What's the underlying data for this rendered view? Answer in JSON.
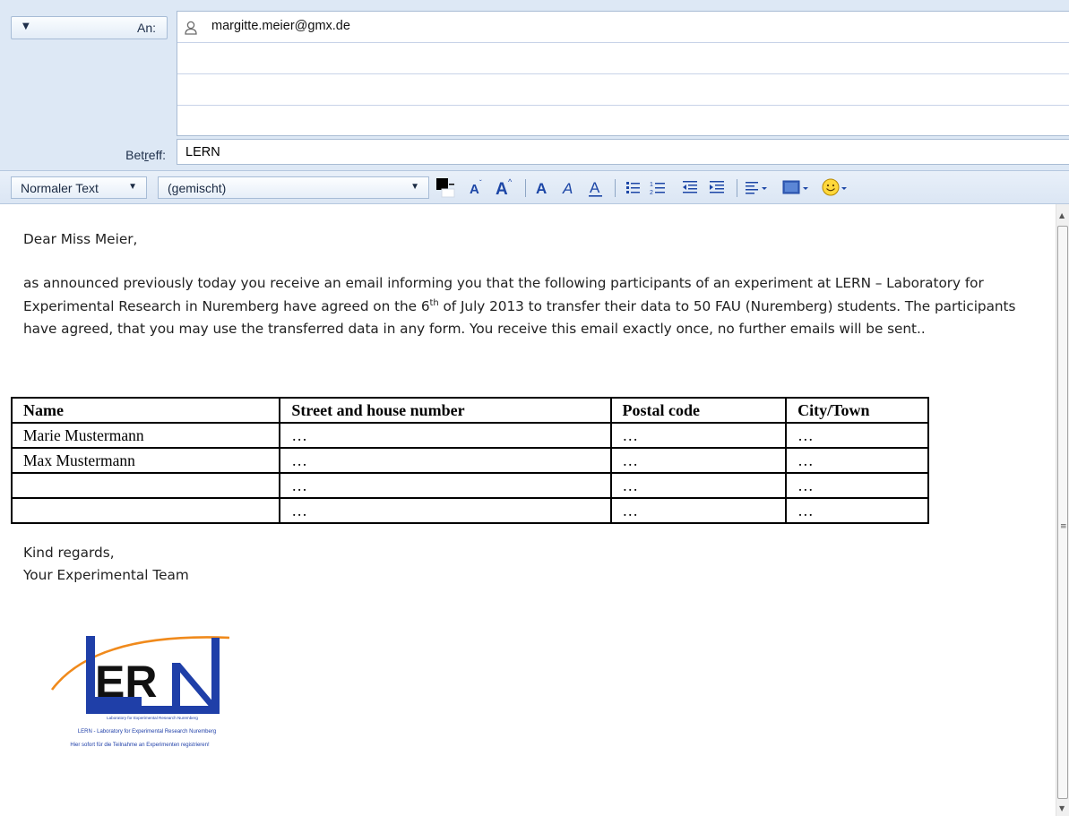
{
  "compose": {
    "address_type": "An:",
    "recipients": [
      "margitte.meier@gmx.de",
      "",
      "",
      ""
    ],
    "subject_label_pre": "Bet",
    "subject_label_key": "r",
    "subject_label_post": "eff:",
    "subject": "LERN"
  },
  "toolbar": {
    "paragraph_style": "Normaler Text",
    "font": "(gemischt)",
    "icons": [
      "text-color-icon",
      "font-smaller-icon",
      "font-larger-icon",
      "bold-icon",
      "italic-icon",
      "underline-icon",
      "bullet-list-icon",
      "numbered-list-icon",
      "outdent-icon",
      "indent-icon",
      "align-icon",
      "insert-image-icon",
      "smiley-icon"
    ]
  },
  "message": {
    "greeting": "Dear Miss Meier,",
    "paragraph_part1": "as announced previously today you receive an email informing you that the following participants of an experiment at LERN – Laboratory for Experimental Research in Nuremberg have agreed on the 6",
    "paragraph_sup": "th",
    "paragraph_part2": " of July 2013 to transfer their data to 50 FAU (Nuremberg) students. The participants have agreed, that you may use the transferred data in any form. You receive this email exactly once, no further emails will be sent..",
    "table": {
      "headers": [
        "Name",
        "Street and house number",
        "Postal code",
        "City/Town"
      ],
      "rows": [
        [
          "Marie Mustermann",
          "…",
          "…",
          "…"
        ],
        [
          "Max Mustermann",
          "…",
          "…",
          "…"
        ],
        [
          "",
          "…",
          "…",
          "…"
        ],
        [
          "",
          "…",
          "…",
          "…"
        ]
      ]
    },
    "closing_1": "Kind regards,",
    "closing_2": "Your Experimental Team"
  },
  "logo": {
    "wordmark": "LERN",
    "tagline": "Laboratory for Experimental Research Nuremberg",
    "caption_1": "LERN - Laboratory for Experimental Research Nuremberg",
    "caption_2": "Hier sofort für die Teilnahme an Experimenten registrieren!",
    "colors": {
      "blue": "#1f3fa8",
      "orange": "#f08a1c"
    }
  }
}
